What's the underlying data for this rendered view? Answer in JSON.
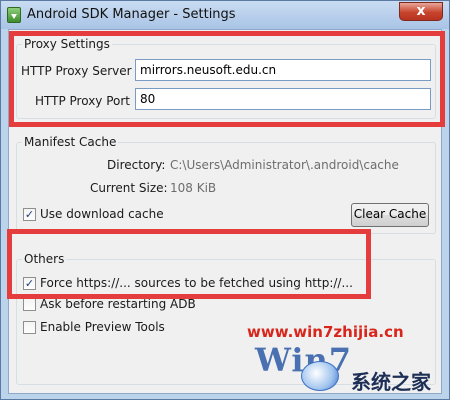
{
  "window": {
    "title": "Android SDK Manager - Settings",
    "close_glyph": "x"
  },
  "proxy": {
    "group_title": "Proxy Settings",
    "server_label": "HTTP Proxy Server",
    "server_value": "mirrors.neusoft.edu.cn",
    "port_label": "HTTP Proxy Port",
    "port_value": "80"
  },
  "manifest": {
    "group_title": "Manifest Cache",
    "directory_label": "Directory:",
    "directory_value": "C:\\Users\\Administrator\\.android\\cache",
    "size_label": "Current Size:",
    "size_value": "108 KiB",
    "use_cache_label": "Use download cache",
    "use_cache_checked": true,
    "clear_button_label": "Clear Cache"
  },
  "others": {
    "group_title": "Others",
    "force_http_label": "Force https://... sources to be fetched using http://...",
    "force_http_checked": true,
    "ask_restart_label": "Ask before restarting ADB",
    "ask_restart_checked": false,
    "preview_tools_label": "Enable Preview Tools",
    "preview_tools_checked": false
  },
  "watermark": {
    "url": "www.win7zhijia.cn",
    "logo": "Win7",
    "cn_text": "系统之家"
  },
  "colors": {
    "highlight": "#e53d3d",
    "watermark_red": "#d8261b",
    "title_gradient": "#bcd3ec"
  }
}
